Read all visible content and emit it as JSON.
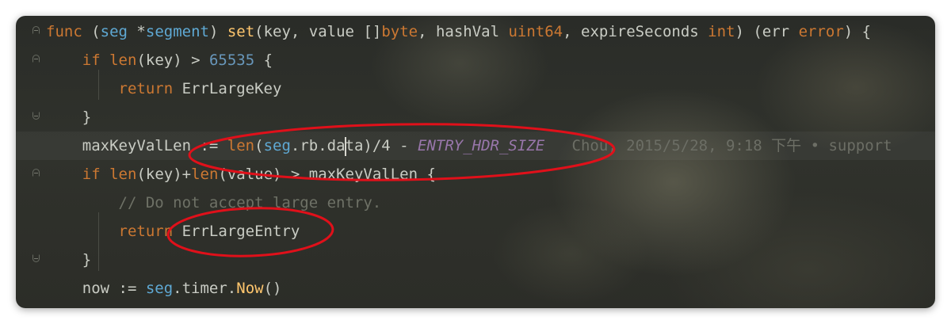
{
  "editor": {
    "lines": [
      {
        "parts": [
          {
            "t": "func",
            "c": "kw"
          },
          {
            "t": " (",
            "c": ""
          },
          {
            "t": "seg",
            "c": "recv"
          },
          {
            "t": " *",
            "c": ""
          },
          {
            "t": "segment",
            "c": "recv"
          },
          {
            "t": ") ",
            "c": ""
          },
          {
            "t": "set",
            "c": "fn"
          },
          {
            "t": "(key, value []",
            "c": ""
          },
          {
            "t": "byte",
            "c": "kw"
          },
          {
            "t": ", hashVal ",
            "c": ""
          },
          {
            "t": "uint64",
            "c": "kw"
          },
          {
            "t": ", expireSeconds ",
            "c": ""
          },
          {
            "t": "int",
            "c": "kw"
          },
          {
            "t": ") (err ",
            "c": ""
          },
          {
            "t": "error",
            "c": "kw"
          },
          {
            "t": ") {",
            "c": ""
          }
        ]
      },
      {
        "parts": [
          {
            "t": "    ",
            "c": ""
          },
          {
            "t": "if",
            "c": "kw"
          },
          {
            "t": " ",
            "c": ""
          },
          {
            "t": "len",
            "c": "builtin"
          },
          {
            "t": "(key) > ",
            "c": ""
          },
          {
            "t": "65535",
            "c": "num"
          },
          {
            "t": " {",
            "c": ""
          }
        ]
      },
      {
        "parts": [
          {
            "t": "        ",
            "c": ""
          },
          {
            "t": "return",
            "c": "kw"
          },
          {
            "t": " ErrLargeKey",
            "c": ""
          }
        ]
      },
      {
        "parts": [
          {
            "t": "    }",
            "c": ""
          }
        ]
      },
      {
        "parts": [
          {
            "t": "    maxKeyValLen := ",
            "c": ""
          },
          {
            "t": "len",
            "c": "builtin"
          },
          {
            "t": "(",
            "c": ""
          },
          {
            "t": "seg",
            "c": "recv"
          },
          {
            "t": ".rb.da",
            "c": ""
          },
          {
            "t": "|",
            "c": "caret"
          },
          {
            "t": "ta)/4 - ",
            "c": ""
          },
          {
            "t": "ENTRY_HDR_SIZE",
            "c": "const"
          },
          {
            "t": "   Chou, 2015/5/28, 9:18 下午 • support",
            "c": "blame"
          }
        ]
      },
      {
        "parts": [
          {
            "t": "    ",
            "c": ""
          },
          {
            "t": "if",
            "c": "kw"
          },
          {
            "t": " ",
            "c": ""
          },
          {
            "t": "len",
            "c": "builtin"
          },
          {
            "t": "(key)+",
            "c": ""
          },
          {
            "t": "len",
            "c": "builtin"
          },
          {
            "t": "(value) > maxKeyValLen {",
            "c": ""
          }
        ]
      },
      {
        "parts": [
          {
            "t": "        ",
            "c": ""
          },
          {
            "t": "// Do not accept large entry.",
            "c": "cmt"
          }
        ]
      },
      {
        "parts": [
          {
            "t": "        ",
            "c": ""
          },
          {
            "t": "return",
            "c": "kw"
          },
          {
            "t": " ErrLargeEntry",
            "c": ""
          }
        ]
      },
      {
        "parts": [
          {
            "t": "    }",
            "c": ""
          }
        ]
      },
      {
        "parts": [
          {
            "t": "    now := ",
            "c": ""
          },
          {
            "t": "seg",
            "c": "recv"
          },
          {
            "t": ".timer.",
            "c": ""
          },
          {
            "t": "Now",
            "c": "method"
          },
          {
            "t": "()",
            "c": ""
          }
        ]
      }
    ]
  },
  "colors": {
    "keyword": "#cc7832",
    "function": "#ffc66d",
    "number": "#6897bb",
    "constant": "#9876aa",
    "comment": "#6e7166",
    "receiver": "#5fa9d4",
    "annotation": "#e0101a"
  },
  "icons": {
    "fold_open": "fold-open-icon",
    "fold_close": "fold-close-icon"
  }
}
